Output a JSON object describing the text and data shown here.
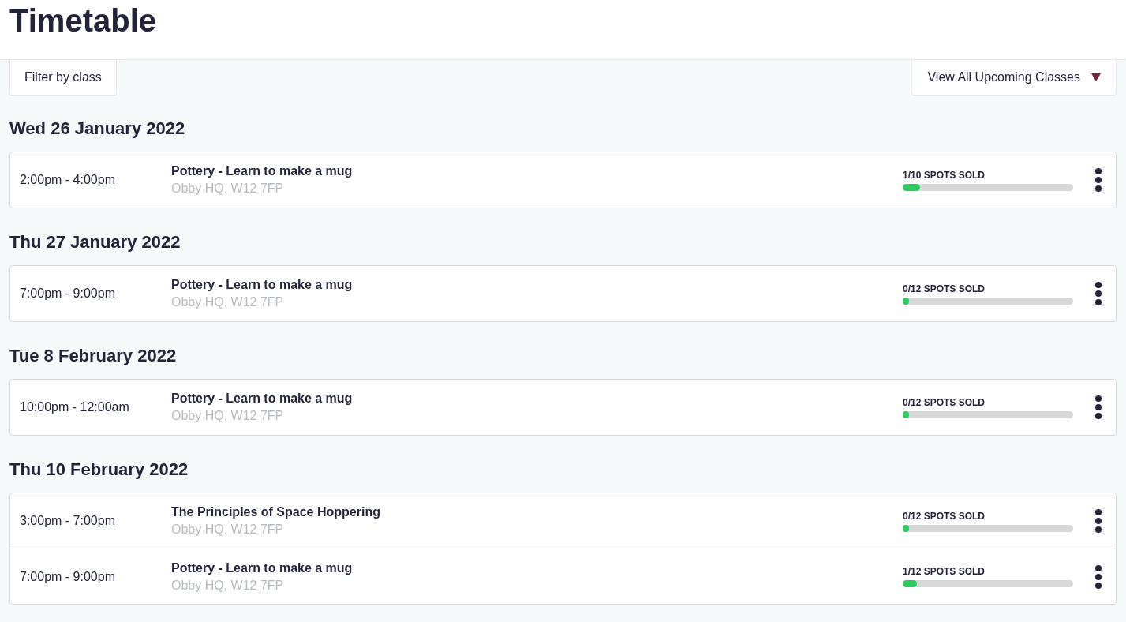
{
  "page": {
    "title": "Timetable"
  },
  "toolbar": {
    "filter_button": "Filter by class",
    "view_dropdown": "View All Upcoming Classes"
  },
  "days": [
    {
      "date": "Wed 26 January 2022",
      "sessions": [
        {
          "time": "2:00pm - 4:00pm",
          "class": "Pottery - Learn to make a mug",
          "location": "Obby HQ, W12 7FP",
          "spots": "1/10 SPOTS SOLD",
          "level": 0.1
        }
      ]
    },
    {
      "date": "Thu 27 January 2022",
      "sessions": [
        {
          "time": "7:00pm - 9:00pm",
          "class": "Pottery - Learn to make a mug",
          "location": "Obby HQ, W12 7FP",
          "spots": "0/12 SPOTS SOLD",
          "level": 0
        }
      ]
    },
    {
      "date": "Tue 8 February 2022",
      "sessions": [
        {
          "time": "10:00pm - 12:00am",
          "class": "Pottery - Learn to make a mug",
          "location": "Obby HQ, W12 7FP",
          "spots": "0/12 SPOTS SOLD",
          "level": 0
        }
      ]
    },
    {
      "date": "Thu 10 February 2022",
      "sessions": [
        {
          "time": "3:00pm - 7:00pm",
          "class": "The Principles of Space Hoppering",
          "location": "Obby HQ, W12 7FP",
          "spots": "0/12 SPOTS SOLD",
          "level": 0
        },
        {
          "time": "7:00pm - 9:00pm",
          "class": "Pottery - Learn to make a mug",
          "location": "Obby HQ, W12 7FP",
          "spots": "1/12 SPOTS SOLD",
          "level": 0.083
        }
      ]
    }
  ]
}
